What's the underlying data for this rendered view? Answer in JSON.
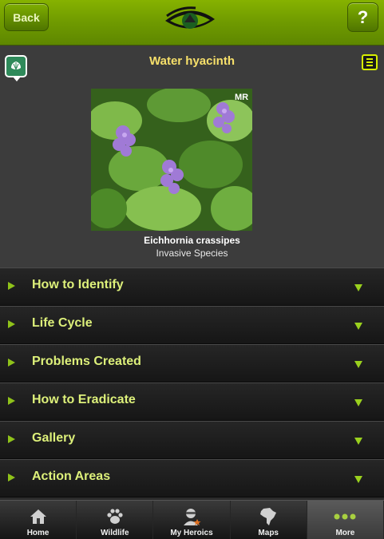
{
  "header": {
    "back_label": "Back",
    "help_label": "?",
    "logo_icon": "eye-logo-icon"
  },
  "species": {
    "title": "Water hyacinth",
    "scientific_name": "Eichhornia crassipes",
    "status": "Invasive Species",
    "photo_watermark": "MR",
    "colors": {
      "title": "#f7e06a",
      "accent": "#8fc21a"
    }
  },
  "sections": [
    {
      "label": "How to Identify"
    },
    {
      "label": "Life Cycle"
    },
    {
      "label": "Problems Created"
    },
    {
      "label": "How to Eradicate"
    },
    {
      "label": "Gallery"
    },
    {
      "label": "Action Areas"
    }
  ],
  "tabs": [
    {
      "label": "Home",
      "icon": "home-icon"
    },
    {
      "label": "Wildlife",
      "icon": "paw-icon"
    },
    {
      "label": "My Heroics",
      "icon": "hero-icon"
    },
    {
      "label": "Maps",
      "icon": "africa-map-icon"
    },
    {
      "label": "More",
      "icon": "more-dots-icon",
      "active": true
    }
  ]
}
